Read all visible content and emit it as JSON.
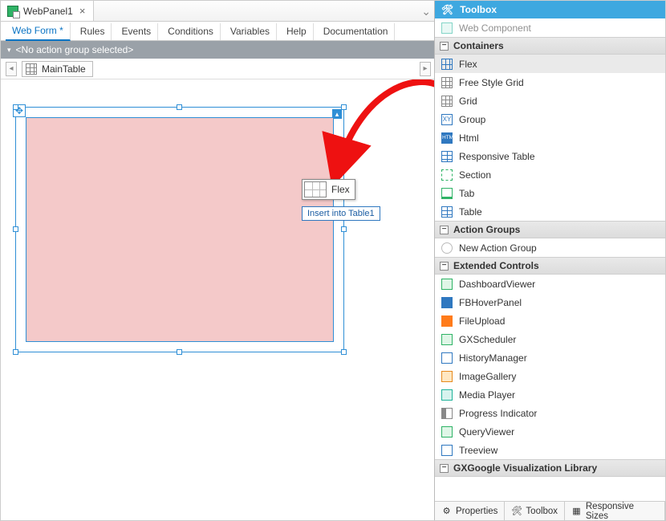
{
  "doc_tab": {
    "title": "WebPanel1"
  },
  "sub_tabs": [
    "Web Form *",
    "Rules",
    "Events",
    "Conditions",
    "Variables",
    "Help",
    "Documentation"
  ],
  "action_group_text": "<No action group selected>",
  "breadcrumb": {
    "label": "MainTable"
  },
  "drag": {
    "label": "Flex",
    "tooltip": "Insert into Table1"
  },
  "toolbox": {
    "title": "Toolbox",
    "top_item": "Web Component",
    "sections": [
      {
        "title": "Containers",
        "items": [
          "Flex",
          "Free Style Grid",
          "Grid",
          "Group",
          "Html",
          "Responsive Table",
          "Section",
          "Tab",
          "Table"
        ],
        "highlight": "Flex"
      },
      {
        "title": "Action Groups",
        "items": [
          "New Action Group"
        ]
      },
      {
        "title": "Extended Controls",
        "items": [
          "DashboardViewer",
          "FBHoverPanel",
          "FileUpload",
          "GXScheduler",
          "HistoryManager",
          "ImageGallery",
          "Media Player",
          "Progress Indicator",
          "QueryViewer",
          "Treeview"
        ]
      },
      {
        "title": "GXGoogle Visualization Library",
        "items": []
      }
    ]
  },
  "bottom_tabs": [
    "Properties",
    "Toolbox",
    "Responsive Sizes"
  ]
}
